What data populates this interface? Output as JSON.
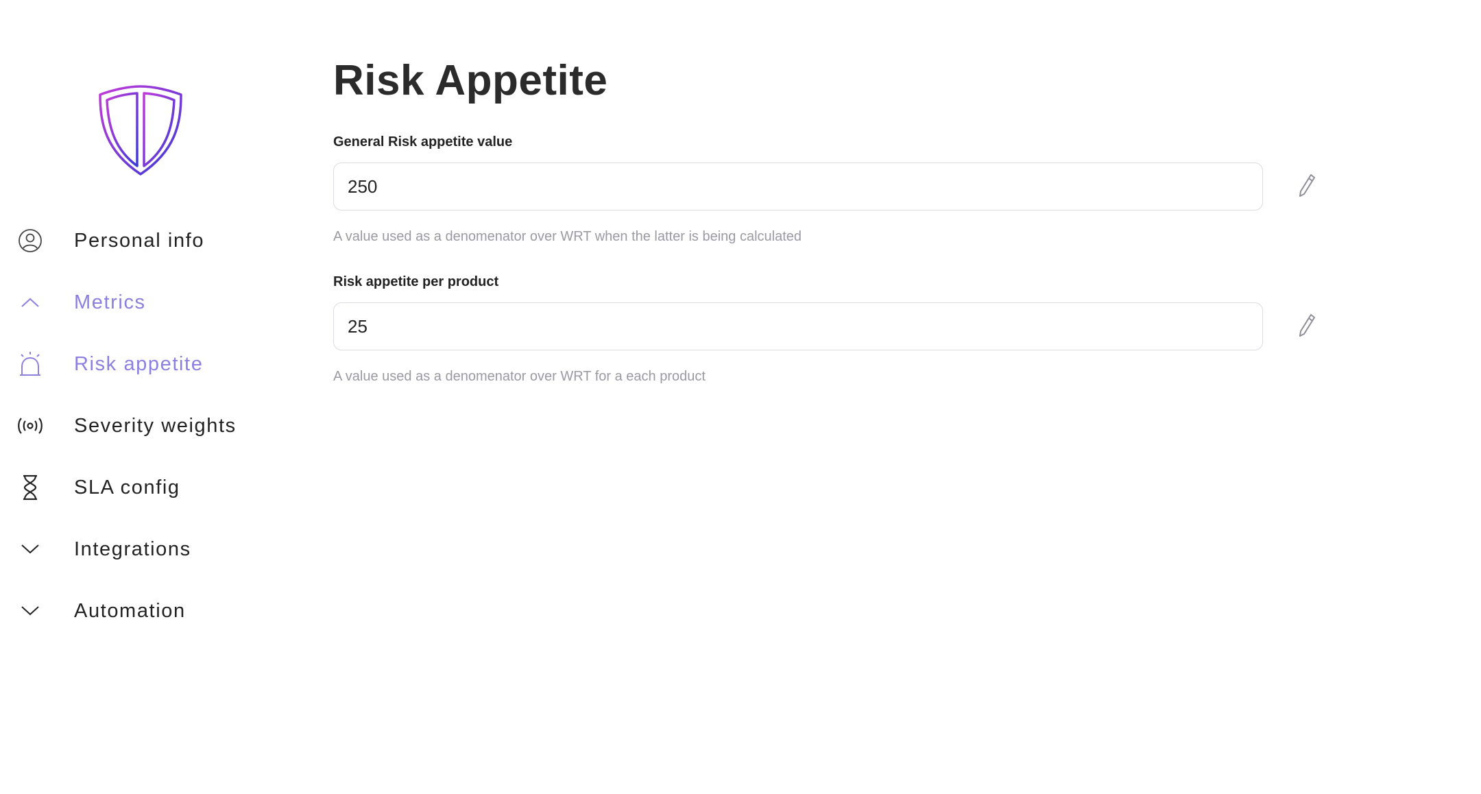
{
  "sidebar": {
    "logo_icon": "shield-logo",
    "items": [
      {
        "label": "Personal info",
        "icon": "user-circle-icon"
      },
      {
        "label": "Metrics",
        "icon": "chevron-up-icon"
      },
      {
        "label": "Risk appetite",
        "icon": "alarm-bell-icon"
      },
      {
        "label": "Severity weights",
        "icon": "broadcast-icon"
      },
      {
        "label": "SLA config",
        "icon": "hourglass-icon"
      },
      {
        "label": "Integrations",
        "icon": "chevron-down-icon"
      },
      {
        "label": "Automation",
        "icon": "chevron-down-icon"
      }
    ]
  },
  "main": {
    "title": "Risk Appetite",
    "fields": [
      {
        "label": "General Risk appetite value",
        "value": "250",
        "help": "A value used as a denomenator over WRT when the latter is being calculated"
      },
      {
        "label": "Risk appetite per product",
        "value": "25",
        "help": "A value used as a denomenator over WRT for a each product"
      }
    ]
  },
  "colors": {
    "accent": "#8b7fe0",
    "text": "#222222",
    "muted": "#9a9aa2",
    "border": "#dcdce2",
    "logo_gradient_start": "#c23ad9",
    "logo_gradient_end": "#3b3bd6"
  }
}
